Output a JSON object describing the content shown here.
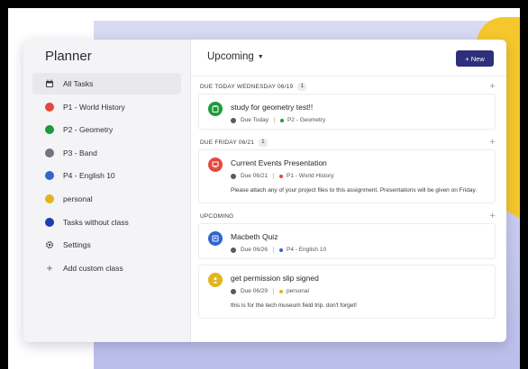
{
  "colors": {
    "p1": "#e5473d",
    "p2": "#1e9a3c",
    "p3": "#707480",
    "p4": "#2f66d0",
    "personal": "#e3b41b",
    "no_class": "#1f3ea8",
    "new_button": "#2d2f7c"
  },
  "sidebar": {
    "title": "Planner",
    "items": [
      {
        "label": "All Tasks",
        "icon": "calendar-icon"
      },
      {
        "label": "P1 - World History",
        "color": "#e5473d"
      },
      {
        "label": "P2 - Geometry",
        "color": "#1e9a3c"
      },
      {
        "label": "P3 - Band",
        "color": "#707480"
      },
      {
        "label": "P4 - English 10",
        "color": "#2f66d0"
      },
      {
        "label": "personal",
        "color": "#e3b41b"
      },
      {
        "label": "Tasks without class",
        "color": "#1f3ea8"
      },
      {
        "label": "Settings",
        "icon": "gear-icon"
      },
      {
        "label": "Add custom class",
        "icon": "plus-icon"
      }
    ]
  },
  "header": {
    "view": "Upcoming",
    "new_label": "+ New"
  },
  "sections": [
    {
      "heading": "DUE TODAY WEDNESDAY 06/19",
      "count": "1",
      "tasks": [
        {
          "title": "study for geometry test!!",
          "due": "Due Today",
          "class": "P2 - Geometry",
          "icon": "clipboard-icon"
        }
      ]
    },
    {
      "heading": "DUE FRIDAY 06/21",
      "count": "1",
      "tasks": [
        {
          "title": "Current Events Presentation",
          "due": "Due 06/21",
          "class": "P1 - World History",
          "icon": "presentation-icon",
          "note": "Please attach any of your project files to this assignment. Presentations will be given on Friday."
        }
      ]
    },
    {
      "heading": "UPCOMING",
      "tasks": [
        {
          "title": "Macbeth Quiz",
          "due": "Due 06/26",
          "class": "P4 - English 10",
          "icon": "quiz-icon"
        },
        {
          "title": "get permission slip signed",
          "due": "Due 06/29",
          "class": "personal",
          "icon": "person-icon",
          "note": "this is for the tech museum field trip. don't forget!"
        }
      ]
    }
  ]
}
